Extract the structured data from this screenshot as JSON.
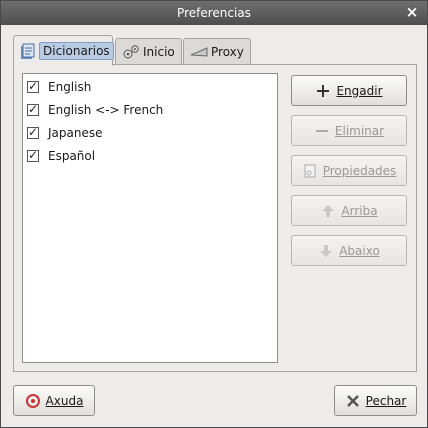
{
  "window": {
    "title": "Preferencias"
  },
  "tabs": [
    {
      "label": "Dicionarios",
      "icon": "dictionary-icon"
    },
    {
      "label": "Inicio",
      "icon": "settings-gears-icon"
    },
    {
      "label": "Proxy",
      "icon": "network-proxy-icon"
    }
  ],
  "dictionaries": [
    {
      "label": "English",
      "checked": true
    },
    {
      "label": "English <-> French",
      "checked": true
    },
    {
      "label": "Japanese",
      "checked": true
    },
    {
      "label": "Español",
      "checked": true
    }
  ],
  "actions": {
    "add": "Engadir",
    "remove": "Eliminar",
    "properties": "Propiedades",
    "up": "Arriba",
    "down": "Abaixo"
  },
  "footer": {
    "help": "Axuda",
    "close": "Pechar"
  },
  "colors": {
    "title_bar": "#5a5a5a",
    "selected_tab": "#b9cbe3",
    "disabled_text": "#9c9a95"
  }
}
